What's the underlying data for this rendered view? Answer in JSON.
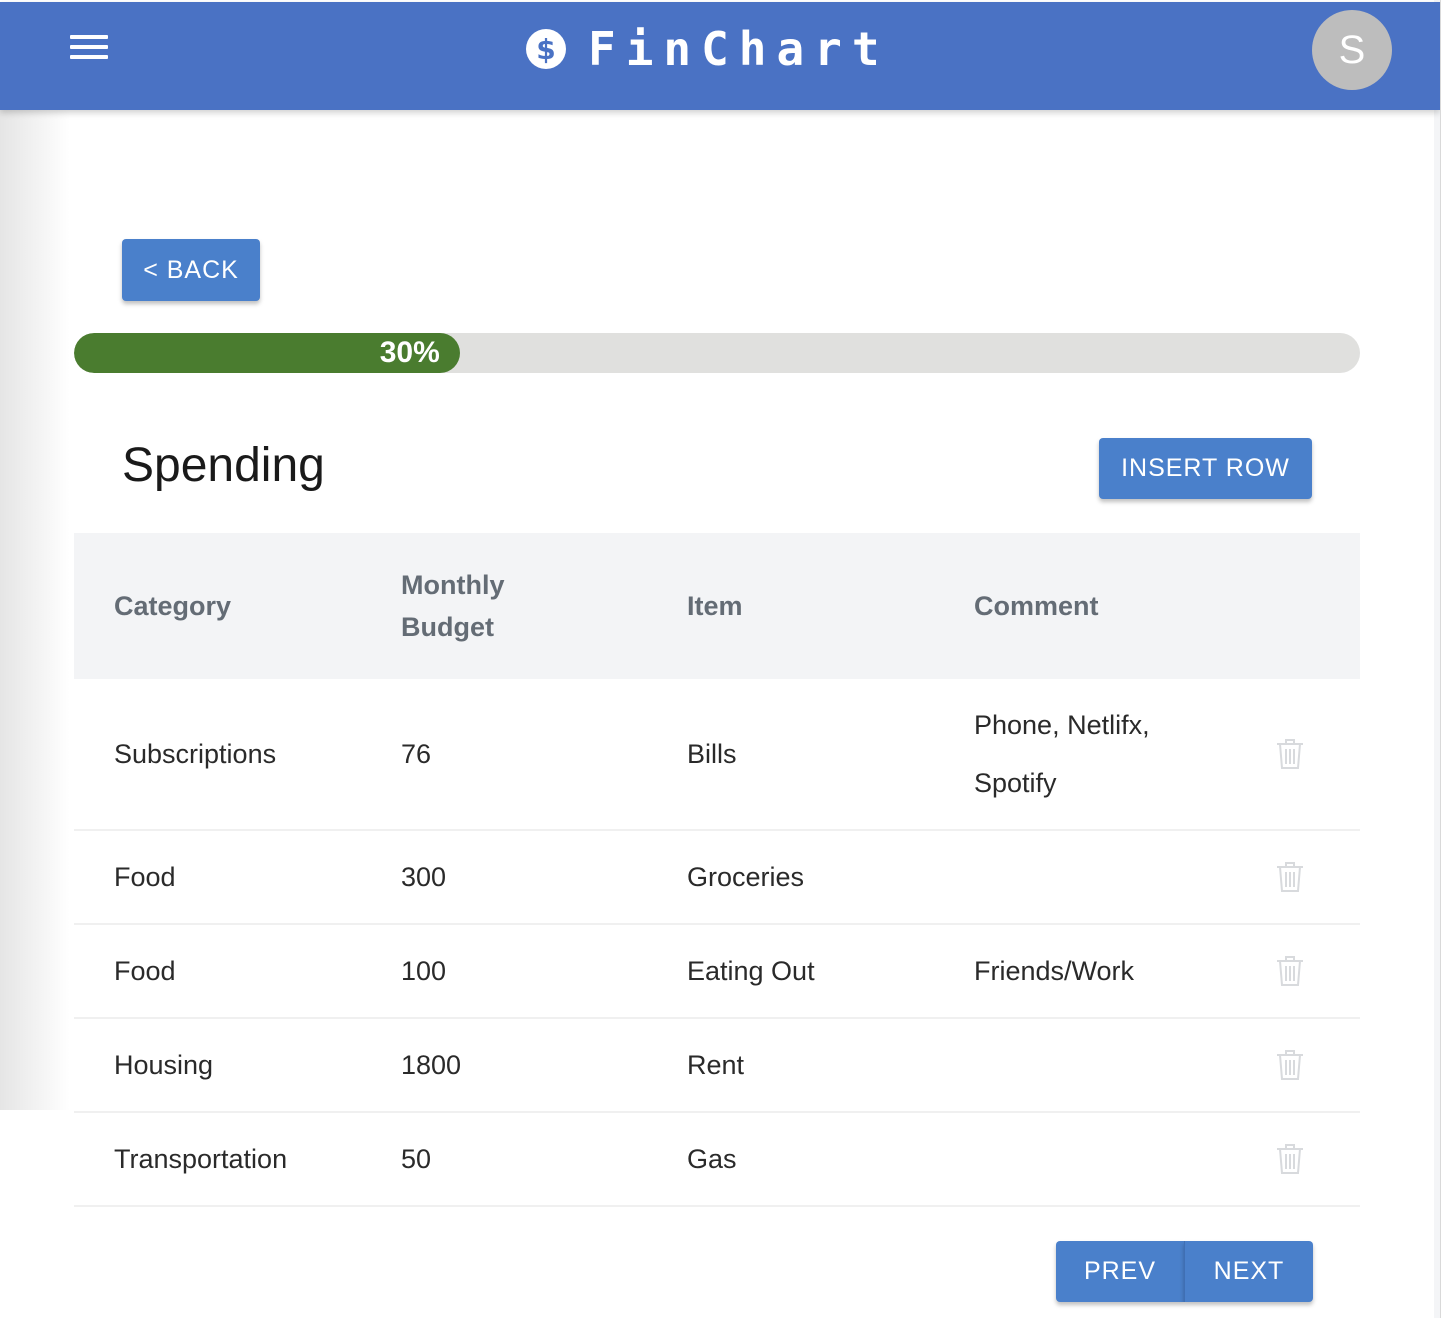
{
  "app": {
    "name": "FinChart",
    "logo_icon": "dollar-circle-icon",
    "avatar_initial": "S"
  },
  "colors": {
    "header": "#4a72c4",
    "button": "#4a80cb",
    "progress_fill": "#4a7c2f",
    "progress_track": "#e0e0de"
  },
  "nav": {
    "back_label": "< BACK"
  },
  "progress": {
    "value_percent": 30,
    "label": "30%"
  },
  "section": {
    "title": "Spending",
    "insert_label": "INSERT ROW"
  },
  "table": {
    "headers": {
      "category": "Category",
      "budget_line1": "Monthly",
      "budget_line2": "Budget",
      "item": "Item",
      "comment": "Comment"
    },
    "rows": [
      {
        "category": "Subscriptions",
        "budget": "76",
        "item": "Bills",
        "comment": "Phone, Netlifx, Spotify"
      },
      {
        "category": "Food",
        "budget": "300",
        "item": "Groceries",
        "comment": ""
      },
      {
        "category": "Food",
        "budget": "100",
        "item": "Eating Out",
        "comment": "Friends/Work"
      },
      {
        "category": "Housing",
        "budget": "1800",
        "item": "Rent",
        "comment": ""
      },
      {
        "category": "Transportation",
        "budget": "50",
        "item": "Gas",
        "comment": ""
      }
    ]
  },
  "pagination": {
    "prev_label": "PREV",
    "next_label": "NEXT"
  }
}
